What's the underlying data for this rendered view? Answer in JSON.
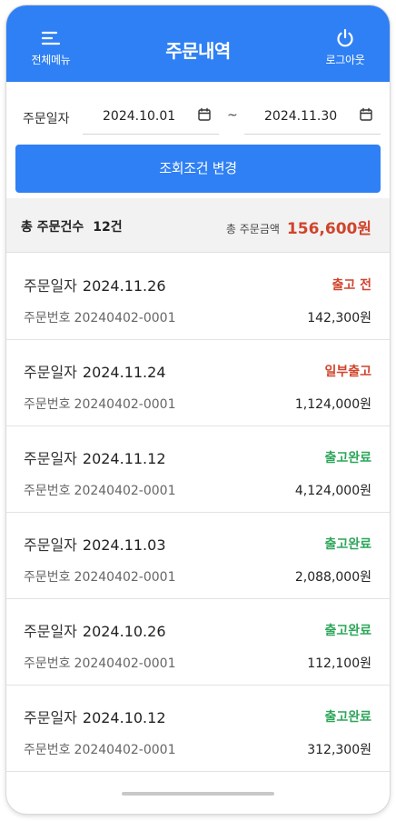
{
  "header": {
    "title": "주문내역",
    "menu_label": "전체메뉴",
    "logout_label": "로그아웃"
  },
  "filter": {
    "label": "주문일자",
    "start_date": "2024.10.01",
    "separator": "~",
    "end_date": "2024.11.30",
    "search_button": "조회조건 변경"
  },
  "summary": {
    "count_label": "총 주문건수",
    "count_value": "12건",
    "amount_label": "총 주문금액",
    "amount_value": "156,600원"
  },
  "order_labels": {
    "date": "주문일자",
    "number": "주문번호"
  },
  "orders": [
    {
      "date": "2024.11.26",
      "number": "20240402-0001",
      "status": "출고 전",
      "status_type": "red",
      "price": "142,300원"
    },
    {
      "date": "2024.11.24",
      "number": "20240402-0001",
      "status": "일부출고",
      "status_type": "red",
      "price": "1,124,000원"
    },
    {
      "date": "2024.11.12",
      "number": "20240402-0001",
      "status": "출고완료",
      "status_type": "green",
      "price": "4,124,000원"
    },
    {
      "date": "2024.11.03",
      "number": "20240402-0001",
      "status": "출고완료",
      "status_type": "green",
      "price": "2,088,000원"
    },
    {
      "date": "2024.10.26",
      "number": "20240402-0001",
      "status": "출고완료",
      "status_type": "green",
      "price": "112,100원"
    },
    {
      "date": "2024.10.12",
      "number": "20240402-0001",
      "status": "출고완료",
      "status_type": "green",
      "price": "312,300원"
    }
  ],
  "colors": {
    "primary": "#2f80f4",
    "status_red": "#d0442c",
    "status_green": "#2ea65b",
    "summary_bg": "#f2f2f2"
  },
  "icons": {
    "menu": "menu-lines-icon",
    "logout": "power-icon",
    "calendar": "calendar-icon"
  }
}
